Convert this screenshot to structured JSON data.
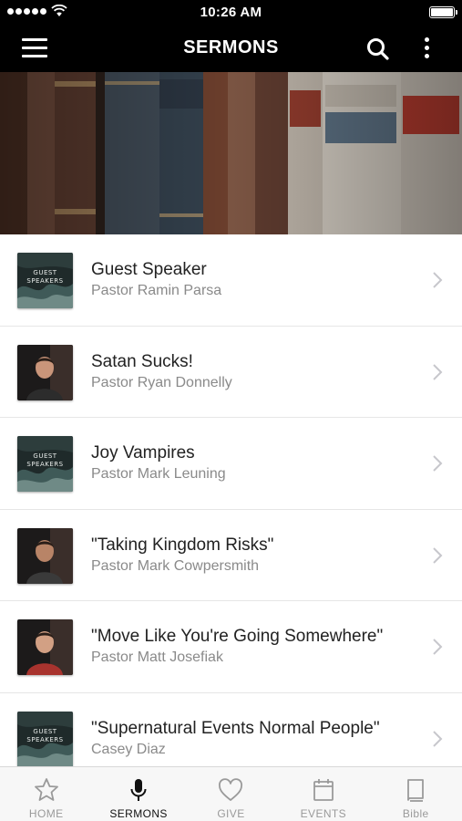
{
  "status_bar": {
    "time": "10:26 AM"
  },
  "nav": {
    "title": "SERMONS",
    "menu_icon": "hamburger-menu-icon",
    "search_icon": "search-icon",
    "more_icon": "more-vertical-icon"
  },
  "hero": {
    "image": "antique-books-on-shelf"
  },
  "sermons": [
    {
      "title": "Guest Speaker",
      "speaker": "Pastor Ramin Parsa",
      "thumbnail": "guest-speakers-graphic",
      "thumbnail_text": "GUEST SPEAKERS"
    },
    {
      "title": "Satan Sucks!",
      "speaker": "Pastor Ryan Donnelly",
      "thumbnail": "speaker-photo"
    },
    {
      "title": "Joy Vampires",
      "speaker": "Pastor Mark Leuning",
      "thumbnail": "guest-speakers-graphic",
      "thumbnail_text": "GUEST SPEAKERS"
    },
    {
      "title": "\"Taking Kingdom Risks\"",
      "speaker": "Pastor Mark Cowpersmith",
      "thumbnail": "speaker-photo"
    },
    {
      "title": "\"Move Like You're Going Somewhere\"",
      "speaker": "Pastor Matt Josefiak",
      "thumbnail": "speaker-photo"
    },
    {
      "title": "\"Supernatural Events Normal People\"",
      "speaker": "Casey Diaz",
      "thumbnail": "guest-speakers-graphic",
      "thumbnail_text": "GUEST SPEAKERS"
    }
  ],
  "tabs": [
    {
      "label": "HOME",
      "icon": "star-icon",
      "active": false
    },
    {
      "label": "SERMONS",
      "icon": "microphone-icon",
      "active": true
    },
    {
      "label": "GIVE",
      "icon": "heart-icon",
      "active": false
    },
    {
      "label": "EVENTS",
      "icon": "calendar-icon",
      "active": false
    },
    {
      "label": "Bible",
      "icon": "book-icon",
      "active": false
    }
  ],
  "colors": {
    "nav_background": "#000000",
    "tab_active": "#111111",
    "tab_inactive": "#9a9a9a",
    "subtitle": "#8a8a8a"
  }
}
